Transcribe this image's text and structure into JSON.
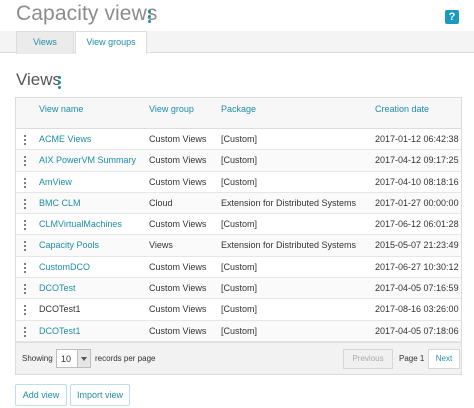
{
  "header": {
    "title": "Capacity views",
    "help_label": "?"
  },
  "tabs": [
    {
      "label": "Views",
      "active": true
    },
    {
      "label": "View groups",
      "active": false
    }
  ],
  "views_section": {
    "title": "Views",
    "columns": [
      "View name",
      "View group",
      "Package",
      "Creation date"
    ],
    "rows": [
      {
        "name": "ACME Views",
        "group": "Custom Views",
        "package": "[Custom]",
        "date": "2017-01-12 06:42:38"
      },
      {
        "name": "AIX PowerVM Summary",
        "group": "Custom Views",
        "package": "[Custom]",
        "date": "2017-04-12 09:17:25"
      },
      {
        "name": "AmView",
        "group": "Custom Views",
        "package": "[Custom]",
        "date": "2017-04-10 08:18:16"
      },
      {
        "name": "BMC CLM",
        "group": "Cloud",
        "package": "Extension for Distributed Systems",
        "date": "2017-01-27 00:00:00"
      },
      {
        "name": "CLMVirtualMachines",
        "group": "Custom Views",
        "package": "[Custom]",
        "date": "2017-06-12 06:01:28"
      },
      {
        "name": "Capacity Pools",
        "group": "Views",
        "package": "Extension for Distributed Systems",
        "date": "2015-05-07 21:23:49"
      },
      {
        "name": "CustomDCO",
        "group": "Custom Views",
        "package": "[Custom]",
        "date": "2017-06-27 10:30:12"
      },
      {
        "name": "DCOTest",
        "group": "Custom Views",
        "package": "[Custom]",
        "date": "2017-04-05 07:16:59"
      },
      {
        "name": "DCOTest1",
        "group": "Custom Views",
        "package": "[Custom]",
        "date": "2017-08-16 03:26:00"
      },
      {
        "name": "DCOTest1",
        "group": "Custom Views",
        "package": "[Custom]",
        "date": "2017-04-05 07:18:06"
      }
    ],
    "link_rows": [
      0,
      1,
      2,
      3,
      4,
      5,
      6,
      7,
      9
    ]
  },
  "pagination": {
    "showing_label": "Showing",
    "page_size": "10",
    "records_label": "records per page",
    "previous_label": "Previous",
    "page_label": "Page 1",
    "next_label": "Next"
  },
  "actions": {
    "add_view": "Add view",
    "import_view": "Import view"
  },
  "colors": {
    "accent": "#1d8ea7",
    "title_gray": "#8c8c8c"
  }
}
